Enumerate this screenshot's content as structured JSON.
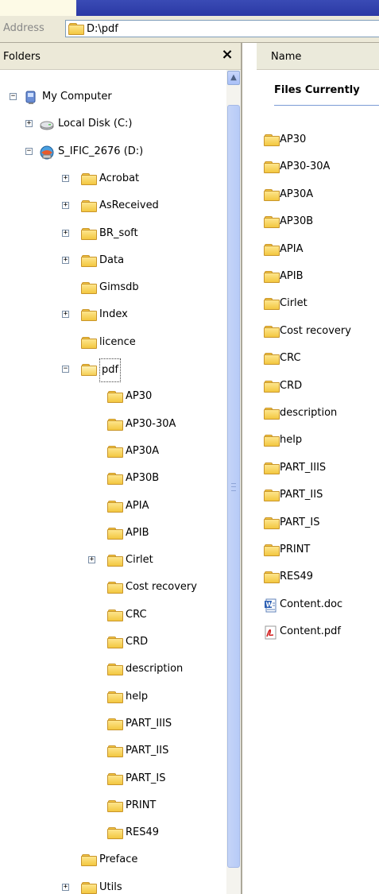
{
  "address": {
    "label": "Address",
    "value": "D:\\pdf"
  },
  "folders_pane": {
    "title": "Folders",
    "close_glyph": "×",
    "tree": [
      {
        "label": "My Computer",
        "level": 0,
        "icon": "computer-icon",
        "expander": "minus"
      },
      {
        "label": "Local Disk (C:)",
        "level": 1,
        "icon": "disk-icon",
        "expander": "plus"
      },
      {
        "label": "S_IFIC_2676 (D:)",
        "level": 1,
        "icon": "network-drive-icon",
        "expander": "minus"
      },
      {
        "label": "Acrobat",
        "level": 2,
        "icon": "folder-icon",
        "expander": "plus"
      },
      {
        "label": "AsReceived",
        "level": 2,
        "icon": "folder-icon",
        "expander": "plus"
      },
      {
        "label": "BR_soft",
        "level": 2,
        "icon": "folder-icon",
        "expander": "plus"
      },
      {
        "label": "Data",
        "level": 2,
        "icon": "folder-icon",
        "expander": "plus"
      },
      {
        "label": "Gimsdb",
        "level": 2,
        "icon": "folder-icon",
        "expander": "none"
      },
      {
        "label": "Index",
        "level": 2,
        "icon": "folder-icon",
        "expander": "plus"
      },
      {
        "label": "licence",
        "level": 2,
        "icon": "folder-icon",
        "expander": "none"
      },
      {
        "label": "pdf",
        "level": 2,
        "icon": "folder-open-icon",
        "expander": "minus",
        "selected": true
      },
      {
        "label": "AP30",
        "level": 3,
        "icon": "folder-icon",
        "expander": "none"
      },
      {
        "label": "AP30-30A",
        "level": 3,
        "icon": "folder-icon",
        "expander": "none"
      },
      {
        "label": "AP30A",
        "level": 3,
        "icon": "folder-icon",
        "expander": "none"
      },
      {
        "label": "AP30B",
        "level": 3,
        "icon": "folder-icon",
        "expander": "none"
      },
      {
        "label": "APIA",
        "level": 3,
        "icon": "folder-icon",
        "expander": "none"
      },
      {
        "label": "APIB",
        "level": 3,
        "icon": "folder-icon",
        "expander": "none"
      },
      {
        "label": "Cirlet",
        "level": 3,
        "icon": "folder-icon",
        "expander": "plus"
      },
      {
        "label": "Cost recovery",
        "level": 3,
        "icon": "folder-icon",
        "expander": "none"
      },
      {
        "label": "CRC",
        "level": 3,
        "icon": "folder-icon",
        "expander": "none"
      },
      {
        "label": "CRD",
        "level": 3,
        "icon": "folder-icon",
        "expander": "none"
      },
      {
        "label": "description",
        "level": 3,
        "icon": "folder-icon",
        "expander": "none"
      },
      {
        "label": "help",
        "level": 3,
        "icon": "folder-icon",
        "expander": "none"
      },
      {
        "label": "PART_IIIS",
        "level": 3,
        "icon": "folder-icon",
        "expander": "none"
      },
      {
        "label": "PART_IIS",
        "level": 3,
        "icon": "folder-icon",
        "expander": "none"
      },
      {
        "label": "PART_IS",
        "level": 3,
        "icon": "folder-icon",
        "expander": "none"
      },
      {
        "label": "PRINT",
        "level": 3,
        "icon": "folder-icon",
        "expander": "none"
      },
      {
        "label": "RES49",
        "level": 3,
        "icon": "folder-icon",
        "expander": "none"
      },
      {
        "label": "Preface",
        "level": 2,
        "icon": "folder-icon",
        "expander": "none"
      },
      {
        "label": "Utils",
        "level": 2,
        "icon": "folder-icon",
        "expander": "plus"
      }
    ]
  },
  "files_pane": {
    "column_name": "Name",
    "group_title": "Files Currently",
    "items": [
      {
        "label": "AP30",
        "icon": "folder-icon"
      },
      {
        "label": "AP30-30A",
        "icon": "folder-icon"
      },
      {
        "label": "AP30A",
        "icon": "folder-icon"
      },
      {
        "label": "AP30B",
        "icon": "folder-icon"
      },
      {
        "label": "APIA",
        "icon": "folder-icon"
      },
      {
        "label": "APIB",
        "icon": "folder-icon"
      },
      {
        "label": "Cirlet",
        "icon": "folder-icon"
      },
      {
        "label": "Cost recovery",
        "icon": "folder-icon"
      },
      {
        "label": "CRC",
        "icon": "folder-icon"
      },
      {
        "label": "CRD",
        "icon": "folder-icon"
      },
      {
        "label": "description",
        "icon": "folder-icon"
      },
      {
        "label": "help",
        "icon": "folder-icon"
      },
      {
        "label": "PART_IIIS",
        "icon": "folder-icon"
      },
      {
        "label": "PART_IIS",
        "icon": "folder-icon"
      },
      {
        "label": "PART_IS",
        "icon": "folder-icon"
      },
      {
        "label": "PRINT",
        "icon": "folder-icon"
      },
      {
        "label": "RES49",
        "icon": "folder-icon"
      },
      {
        "label": "Content.doc",
        "icon": "word-document-icon"
      },
      {
        "label": "Content.pdf",
        "icon": "pdf-document-icon"
      }
    ]
  },
  "colors": {
    "titlebar": "#2b38a4",
    "background": "#fdfae6",
    "toolbar": "#ece9d8",
    "folder": "#f3c740",
    "group_line": "#7b9bd6"
  }
}
